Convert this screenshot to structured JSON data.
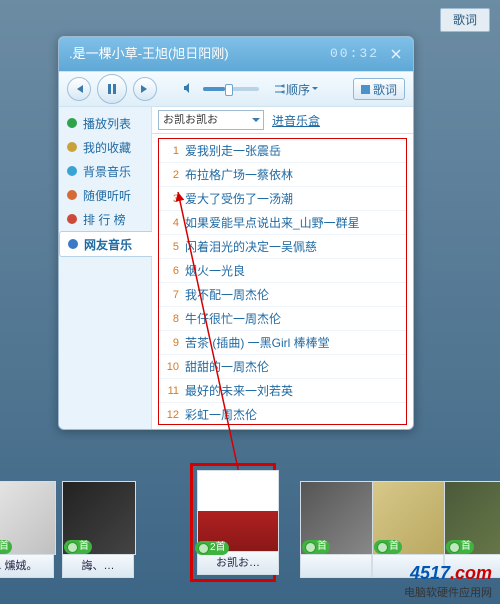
{
  "top_lyrics_label": "歌词",
  "title": {
    "song": ".是一棵小草-王旭(旭日阳刚)",
    "time": "00:32"
  },
  "controls": {
    "mode_label": "顺序",
    "lyrics_btn": "歌词"
  },
  "sidebar": {
    "tabs": [
      {
        "label": "播放列表",
        "color": "#2fa34a"
      },
      {
        "label": "我的收藏",
        "color": "#caa23a"
      },
      {
        "label": "背景音乐",
        "color": "#3aa3d4"
      },
      {
        "label": "随便听听",
        "color": "#d46a3a"
      },
      {
        "label": "排 行 榜",
        "color": "#cc4a3a"
      },
      {
        "label": "网友音乐",
        "color": "#3a7ac4"
      }
    ],
    "selected_index": 5
  },
  "dropdown": {
    "value": "お凯お凯お"
  },
  "music_box_link": "进音乐盒",
  "playlist": [
    {
      "n": "1",
      "title": "爱我别走一张震岳"
    },
    {
      "n": "2",
      "title": "布拉格广场一蔡依林"
    },
    {
      "n": "3",
      "title": "爱大了受伤了一汤潮"
    },
    {
      "n": "4",
      "title": "如果爱能早点说出来_山野一群星"
    },
    {
      "n": "5",
      "title": "闪着泪光的决定一吴佩慈"
    },
    {
      "n": "6",
      "title": "烟火一光良"
    },
    {
      "n": "7",
      "title": "我不配一周杰伦"
    },
    {
      "n": "8",
      "title": "牛仔很忙一周杰伦"
    },
    {
      "n": "9",
      "title": "苦茶 (插曲) 一黑Girl 棒棒堂"
    },
    {
      "n": "10",
      "title": "甜甜的一周杰伦"
    },
    {
      "n": "11",
      "title": "最好的未来一刘若英"
    },
    {
      "n": "12",
      "title": "彩虹一周杰伦"
    }
  ],
  "dock": [
    {
      "caption": ". 燻娀。",
      "badge": "首",
      "pic_bg": "linear-gradient(135deg,#e8e8e8,#c0c0c0)"
    },
    {
      "caption": "誨、…",
      "badge": "首",
      "pic_bg": "linear-gradient(135deg,#222,#444)"
    },
    {
      "caption": "お凯お…",
      "badge": "2首",
      "pic_bg": "linear-gradient(180deg,#fff 0%,#fff 50%,#b02020 50%,#8a1818 100%)",
      "selected": true
    },
    {
      "caption": "",
      "badge": "首",
      "pic_bg": "linear-gradient(135deg,#555,#888)"
    },
    {
      "caption": "",
      "badge": "首",
      "pic_bg": "linear-gradient(135deg,#d8c88a,#b8a860)"
    },
    {
      "caption": "",
      "badge": "首",
      "pic_bg": "linear-gradient(135deg,#4a5a3a,#6a7a4a)"
    }
  ],
  "watermark": {
    "brand_a": "4517",
    "brand_b": ".com",
    "sub": "电脑软硬件应用网"
  }
}
